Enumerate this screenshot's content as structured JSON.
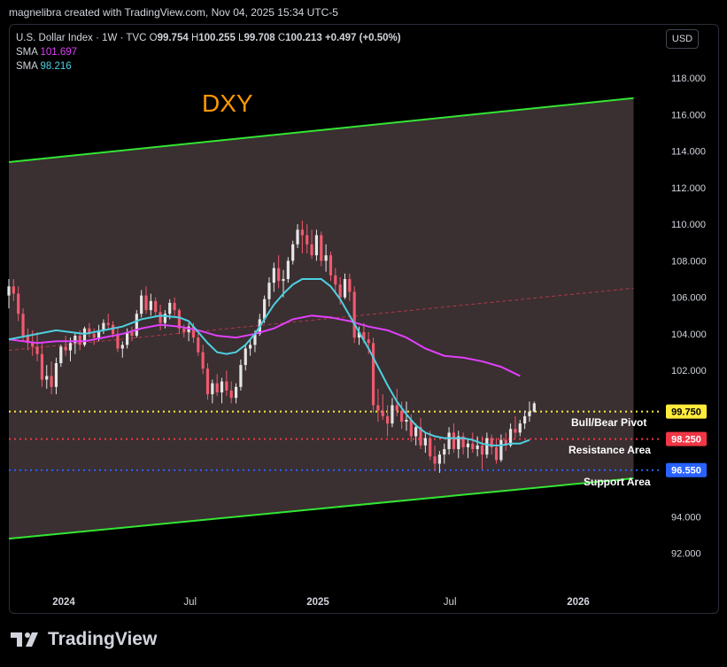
{
  "credit": "magnelibra created with TradingView.com, Nov 04, 2025 15:34 UTC-5",
  "legend": {
    "symbol": "U.S. Dollar Index · 1W · TVC",
    "open_label": "O",
    "open": "99.754",
    "high_label": "H",
    "high": "100.255",
    "low_label": "L",
    "low": "99.708",
    "close_label": "C",
    "close": "100.213",
    "change": "+0.497 (+0.50%)",
    "sma1_label": "SMA",
    "sma1_value": "101.697",
    "sma2_label": "SMA",
    "sma2_value": "98.216"
  },
  "currency_button": "USD",
  "brand": "TradingView",
  "colors": {
    "background": "#000000",
    "channel_fill": "#3d3234",
    "channel_line": "#33e633",
    "up": "#e6e6e6",
    "down": "#f05a6e",
    "sma_long": "#e040fb",
    "sma_short": "#4dd0e1",
    "pivot": "#ffeb3b",
    "resistance": "#f23645",
    "support": "#2962ff"
  },
  "chart_data": {
    "type": "candlestick",
    "title": "DXY",
    "y_ticks": [
      "118.000",
      "116.000",
      "114.000",
      "112.000",
      "110.000",
      "108.000",
      "106.000",
      "104.000",
      "102.000",
      "92.000",
      "94.000"
    ],
    "x_ticks": [
      "2024",
      "Jul",
      "2025",
      "Jul",
      "2026"
    ],
    "ylim": [
      90.7,
      119.5
    ],
    "levels": [
      {
        "name": "Bull/Bear Pivot",
        "value": 99.75,
        "label": "99.750",
        "color": "#ffeb3b"
      },
      {
        "name": "Resistance Area",
        "value": 98.25,
        "label": "98.250",
        "color": "#f23645"
      },
      {
        "name": "Support Area",
        "value": 96.55,
        "label": "96.550",
        "color": "#2962ff"
      }
    ],
    "channel": {
      "upper": [
        {
          "t": 0,
          "v": 113.4
        },
        {
          "t": 132,
          "v": 116.9
        }
      ],
      "lower": [
        {
          "t": 0,
          "v": 92.8
        },
        {
          "t": 132,
          "v": 96.1
        }
      ],
      "mid_dashed": [
        {
          "t": 0,
          "v": 103.1
        },
        {
          "t": 132,
          "v": 106.5
        }
      ]
    },
    "x_tick_positions_weeks": [
      11.6,
      38.3,
      65.3,
      93.2,
      120.3
    ],
    "ohlc_weeks": [
      [
        0,
        106.1,
        107.0,
        105.4,
        106.6
      ],
      [
        1,
        106.6,
        107.0,
        105.8,
        106.2
      ],
      [
        2,
        106.2,
        106.6,
        104.7,
        105.1
      ],
      [
        3,
        105.1,
        105.4,
        103.6,
        103.9
      ],
      [
        4,
        103.9,
        104.3,
        103.1,
        103.5
      ],
      [
        5,
        103.5,
        104.2,
        102.8,
        103.3
      ],
      [
        6,
        103.3,
        104.1,
        102.5,
        102.9
      ],
      [
        7,
        102.9,
        103.5,
        101.1,
        101.5
      ],
      [
        8,
        101.5,
        102.3,
        101.0,
        101.7
      ],
      [
        9,
        101.7,
        102.5,
        100.7,
        101.1
      ],
      [
        10,
        101.1,
        102.7,
        100.7,
        102.4
      ],
      [
        11,
        102.4,
        103.4,
        102.2,
        103.3
      ],
      [
        12,
        103.3,
        103.9,
        102.8,
        103.1
      ],
      [
        13,
        103.1,
        103.8,
        102.5,
        103.5
      ],
      [
        14,
        103.5,
        104.1,
        102.9,
        103.9
      ],
      [
        15,
        103.9,
        104.2,
        103.1,
        103.4
      ],
      [
        16,
        103.4,
        104.4,
        103.3,
        104.3
      ],
      [
        17,
        104.3,
        104.6,
        103.8,
        104.0
      ],
      [
        18,
        104.0,
        104.3,
        103.4,
        103.8
      ],
      [
        19,
        103.8,
        104.5,
        103.6,
        104.2
      ],
      [
        20,
        104.2,
        104.8,
        104.0,
        104.6
      ],
      [
        21,
        104.6,
        105.1,
        104.3,
        104.5
      ],
      [
        22,
        104.5,
        104.7,
        103.8,
        104.0
      ],
      [
        23,
        104.0,
        104.3,
        103.0,
        103.2
      ],
      [
        24,
        103.2,
        103.6,
        102.7,
        103.4
      ],
      [
        25,
        103.4,
        104.3,
        103.2,
        104.1
      ],
      [
        26,
        104.1,
        104.4,
        103.6,
        103.9
      ],
      [
        27,
        103.9,
        105.3,
        103.8,
        105.1
      ],
      [
        28,
        105.1,
        106.4,
        104.9,
        106.1
      ],
      [
        29,
        106.1,
        106.6,
        105.1,
        105.3
      ],
      [
        30,
        105.3,
        106.2,
        105.0,
        105.8
      ],
      [
        31,
        105.8,
        106.0,
        104.9,
        105.2
      ],
      [
        32,
        105.2,
        105.6,
        104.2,
        104.6
      ],
      [
        33,
        104.6,
        105.3,
        104.3,
        105.1
      ],
      [
        34,
        105.1,
        105.9,
        104.8,
        105.7
      ],
      [
        35,
        105.7,
        106.0,
        104.9,
        105.3
      ],
      [
        36,
        105.3,
        105.4,
        104.0,
        104.3
      ],
      [
        37,
        104.3,
        104.5,
        103.8,
        104.1
      ],
      [
        38,
        104.1,
        104.6,
        103.6,
        104.4
      ],
      [
        39,
        104.4,
        104.6,
        103.5,
        103.8
      ],
      [
        40,
        103.8,
        104.2,
        102.8,
        103.0
      ],
      [
        41,
        103.0,
        103.4,
        101.8,
        102.1
      ],
      [
        42,
        102.1,
        102.4,
        100.4,
        100.7
      ],
      [
        43,
        100.7,
        101.5,
        100.2,
        101.3
      ],
      [
        44,
        101.3,
        101.8,
        100.6,
        100.8
      ],
      [
        45,
        100.8,
        101.6,
        100.2,
        101.4
      ],
      [
        46,
        101.4,
        102.0,
        100.6,
        100.9
      ],
      [
        47,
        100.9,
        101.4,
        100.2,
        100.5
      ],
      [
        48,
        100.5,
        101.3,
        100.2,
        101.1
      ],
      [
        49,
        101.1,
        102.6,
        100.9,
        102.3
      ],
      [
        50,
        102.3,
        103.4,
        102.0,
        103.2
      ],
      [
        51,
        103.2,
        103.7,
        102.8,
        103.4
      ],
      [
        52,
        103.4,
        104.2,
        103.0,
        104.0
      ],
      [
        53,
        104.0,
        105.1,
        103.9,
        104.8
      ],
      [
        54,
        104.8,
        106.1,
        104.6,
        105.9
      ],
      [
        55,
        105.9,
        107.1,
        105.5,
        106.8
      ],
      [
        56,
        106.8,
        107.9,
        106.3,
        107.6
      ],
      [
        57,
        107.6,
        108.3,
        106.5,
        106.9
      ],
      [
        58,
        106.9,
        107.5,
        106.0,
        107.0
      ],
      [
        59,
        107.0,
        108.2,
        106.8,
        108.0
      ],
      [
        60,
        108.0,
        109.1,
        107.8,
        108.9
      ],
      [
        61,
        108.9,
        110.0,
        108.7,
        109.7
      ],
      [
        62,
        109.7,
        110.2,
        108.4,
        109.4
      ],
      [
        63,
        109.4,
        110.0,
        108.4,
        108.9
      ],
      [
        64,
        108.9,
        109.7,
        108.1,
        108.3
      ],
      [
        65,
        108.3,
        109.7,
        108.0,
        109.4
      ],
      [
        66,
        109.4,
        109.6,
        107.7,
        108.0
      ],
      [
        67,
        108.0,
        108.9,
        107.4,
        108.3
      ],
      [
        68,
        108.3,
        108.5,
        106.9,
        107.2
      ],
      [
        69,
        107.2,
        107.6,
        106.3,
        106.7
      ],
      [
        70,
        106.7,
        107.1,
        105.6,
        106.0
      ],
      [
        71,
        106.0,
        107.3,
        105.9,
        107.0
      ],
      [
        72,
        107.0,
        107.3,
        105.8,
        106.3
      ],
      [
        73,
        106.3,
        106.6,
        103.5,
        103.8
      ],
      [
        74,
        103.8,
        104.4,
        103.4,
        104.1
      ],
      [
        75,
        104.1,
        104.6,
        103.5,
        103.7
      ],
      [
        76,
        103.7,
        104.1,
        102.9,
        103.5
      ],
      [
        77,
        103.5,
        103.8,
        99.7,
        100.1
      ],
      [
        78,
        100.1,
        101.0,
        99.2,
        99.8
      ],
      [
        79,
        99.8,
        100.7,
        99.3,
        99.5
      ],
      [
        80,
        99.5,
        100.1,
        98.4,
        99.1
      ],
      [
        81,
        99.1,
        100.5,
        98.9,
        100.1
      ],
      [
        82,
        100.1,
        101.0,
        99.5,
        99.8
      ],
      [
        83,
        99.8,
        100.3,
        98.8,
        99.2
      ],
      [
        84,
        99.2,
        100.3,
        98.7,
        99.3
      ],
      [
        85,
        99.3,
        99.6,
        98.1,
        98.4
      ],
      [
        86,
        98.4,
        99.1,
        97.9,
        98.9
      ],
      [
        87,
        98.9,
        99.4,
        97.7,
        97.9
      ],
      [
        88,
        97.9,
        98.6,
        97.5,
        98.3
      ],
      [
        89,
        98.3,
        98.7,
        97.1,
        97.3
      ],
      [
        90,
        97.3,
        97.9,
        96.5,
        96.9
      ],
      [
        91,
        96.9,
        97.6,
        96.4,
        97.4
      ],
      [
        92,
        97.4,
        98.0,
        96.9,
        97.7
      ],
      [
        93,
        97.7,
        98.9,
        97.4,
        98.6
      ],
      [
        94,
        98.6,
        99.1,
        97.5,
        97.7
      ],
      [
        95,
        97.7,
        98.7,
        97.2,
        98.4
      ],
      [
        96,
        98.4,
        98.6,
        97.4,
        97.8
      ],
      [
        97,
        97.8,
        98.2,
        97.2,
        98.0
      ],
      [
        98,
        98.0,
        98.6,
        97.5,
        97.7
      ],
      [
        99,
        97.7,
        98.4,
        97.3,
        97.9
      ],
      [
        100,
        97.9,
        98.4,
        96.6,
        97.4
      ],
      [
        101,
        97.4,
        98.6,
        97.2,
        98.3
      ],
      [
        102,
        98.3,
        98.5,
        97.4,
        97.8
      ],
      [
        103,
        97.8,
        98.3,
        96.9,
        97.1
      ],
      [
        104,
        97.1,
        98.5,
        97.0,
        98.2
      ],
      [
        105,
        98.2,
        98.6,
        97.6,
        97.9
      ],
      [
        106,
        97.9,
        99.1,
        97.8,
        98.8
      ],
      [
        107,
        98.8,
        99.5,
        98.3,
        98.6
      ],
      [
        108,
        98.6,
        99.3,
        98.4,
        99.1
      ],
      [
        109,
        99.1,
        99.8,
        98.8,
        99.5
      ],
      [
        110,
        99.5,
        100.3,
        99.2,
        99.75
      ],
      [
        111,
        99.75,
        100.3,
        99.7,
        100.2
      ]
    ],
    "sma_short": [
      [
        0,
        103.7
      ],
      [
        6,
        104.0
      ],
      [
        10,
        104.2
      ],
      [
        16,
        104.0
      ],
      [
        20,
        104.2
      ],
      [
        24,
        104.4
      ],
      [
        28,
        104.8
      ],
      [
        32,
        105.0
      ],
      [
        36,
        104.9
      ],
      [
        38,
        104.7
      ],
      [
        40,
        104.1
      ],
      [
        42,
        103.5
      ],
      [
        44,
        103.0
      ],
      [
        46,
        102.9
      ],
      [
        48,
        103.0
      ],
      [
        50,
        103.4
      ],
      [
        52,
        104.0
      ],
      [
        54,
        104.8
      ],
      [
        56,
        105.6
      ],
      [
        58,
        106.2
      ],
      [
        60,
        106.7
      ],
      [
        62,
        107.0
      ],
      [
        64,
        107.0
      ],
      [
        66,
        107.0
      ],
      [
        68,
        106.6
      ],
      [
        70,
        105.9
      ],
      [
        72,
        105.0
      ],
      [
        74,
        104.1
      ],
      [
        76,
        103.2
      ],
      [
        78,
        102.2
      ],
      [
        80,
        101.2
      ],
      [
        82,
        100.3
      ],
      [
        84,
        99.6
      ],
      [
        86,
        99.0
      ],
      [
        88,
        98.6
      ],
      [
        90,
        98.4
      ],
      [
        92,
        98.3
      ],
      [
        94,
        98.3
      ],
      [
        96,
        98.3
      ],
      [
        98,
        98.2
      ],
      [
        100,
        98.0
      ],
      [
        102,
        97.9
      ],
      [
        104,
        97.9
      ],
      [
        106,
        98.0
      ],
      [
        108,
        98.0
      ],
      [
        110,
        98.2
      ]
    ],
    "sma_long": [
      [
        0,
        103.7
      ],
      [
        6,
        103.5
      ],
      [
        10,
        103.6
      ],
      [
        16,
        103.6
      ],
      [
        20,
        103.8
      ],
      [
        24,
        104.0
      ],
      [
        28,
        104.3
      ],
      [
        32,
        104.5
      ],
      [
        36,
        104.4
      ],
      [
        40,
        104.2
      ],
      [
        44,
        103.9
      ],
      [
        48,
        103.8
      ],
      [
        52,
        104.0
      ],
      [
        56,
        104.3
      ],
      [
        60,
        104.8
      ],
      [
        64,
        105.0
      ],
      [
        68,
        104.9
      ],
      [
        72,
        104.7
      ],
      [
        76,
        104.4
      ],
      [
        80,
        104.2
      ],
      [
        84,
        103.8
      ],
      [
        88,
        103.2
      ],
      [
        92,
        102.8
      ],
      [
        96,
        102.7
      ],
      [
        100,
        102.5
      ],
      [
        104,
        102.2
      ],
      [
        108,
        101.7
      ]
    ]
  }
}
